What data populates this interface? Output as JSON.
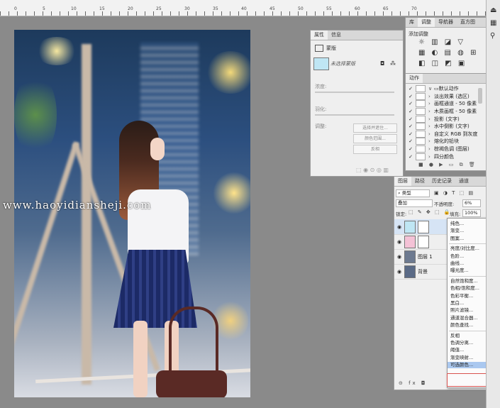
{
  "ruler": {
    "numbers": [
      "0",
      "5",
      "10",
      "15",
      "20",
      "25",
      "30",
      "35",
      "40",
      "45",
      "50",
      "55",
      "60",
      "65",
      "70"
    ]
  },
  "watermark": "www.haoyidiansheji.com",
  "properties": {
    "tabs": [
      "属性",
      "信息"
    ],
    "section_label": "蒙版",
    "layer_name": "未选择蒙版",
    "density_label": "浓度:",
    "feather_label": "羽化:",
    "refine_label": "调整:",
    "btn_select_mask": "选择并遮住...",
    "btn_color_range": "颜色范围...",
    "btn_invert": "反相"
  },
  "adjustments": {
    "tabs": [
      "库",
      "调整",
      "导航器",
      "直方图"
    ],
    "title": "添加调整"
  },
  "actions": {
    "tab": "动作",
    "items": [
      {
        "arrow": "∨",
        "label": "默认动作",
        "folder": true
      },
      {
        "arrow": "›",
        "label": "淡出效果 (选区)"
      },
      {
        "arrow": "›",
        "label": "画框通道 - 50 像素"
      },
      {
        "arrow": "›",
        "label": "木质画框 - 50 像素"
      },
      {
        "arrow": "›",
        "label": "投影 (文字)"
      },
      {
        "arrow": "›",
        "label": "水中倒影 (文字)"
      },
      {
        "arrow": "›",
        "label": "自定义 RGB 到灰度"
      },
      {
        "arrow": "›",
        "label": "熔化的铅块"
      },
      {
        "arrow": "›",
        "label": "棕褐色调 (图层)"
      },
      {
        "arrow": "›",
        "label": "四分颜色"
      }
    ]
  },
  "layers": {
    "tabs": [
      "图层",
      "路径",
      "历史记录",
      "通道"
    ],
    "filter_label": "类型",
    "blend_mode": "叠加",
    "opacity_label": "不透明度:",
    "opacity_value": "6%",
    "lock_label": "锁定:",
    "fill_label": "填充:",
    "fill_value": "100%",
    "rows": [
      {
        "name": "",
        "color": "#bfe6f4",
        "mask": true
      },
      {
        "name": "",
        "color": "#f4c2d6",
        "mask": true
      },
      {
        "name": "图层 1",
        "color": "#6d7a90",
        "mask": false
      },
      {
        "name": "背景",
        "color": "#5a6a86",
        "mask": false
      }
    ]
  },
  "menu": {
    "groups": [
      [
        "纯色...",
        "渐变...",
        "图案..."
      ],
      [
        "亮度/对比度...",
        "色阶...",
        "曲线...",
        "曝光度..."
      ],
      [
        "自然饱和度...",
        "色相/饱和度...",
        "色彩平衡...",
        "黑白...",
        "照片滤镜...",
        "通道混合器...",
        "颜色查找..."
      ],
      [
        "反相",
        "色调分离...",
        "阈值...",
        "渐变映射...",
        "可选颜色..."
      ]
    ],
    "highlighted": "可选颜色..."
  },
  "colors": {
    "panel_bg": "#efefef",
    "highlight": "#aac8ef",
    "callout": "#d9534f"
  }
}
